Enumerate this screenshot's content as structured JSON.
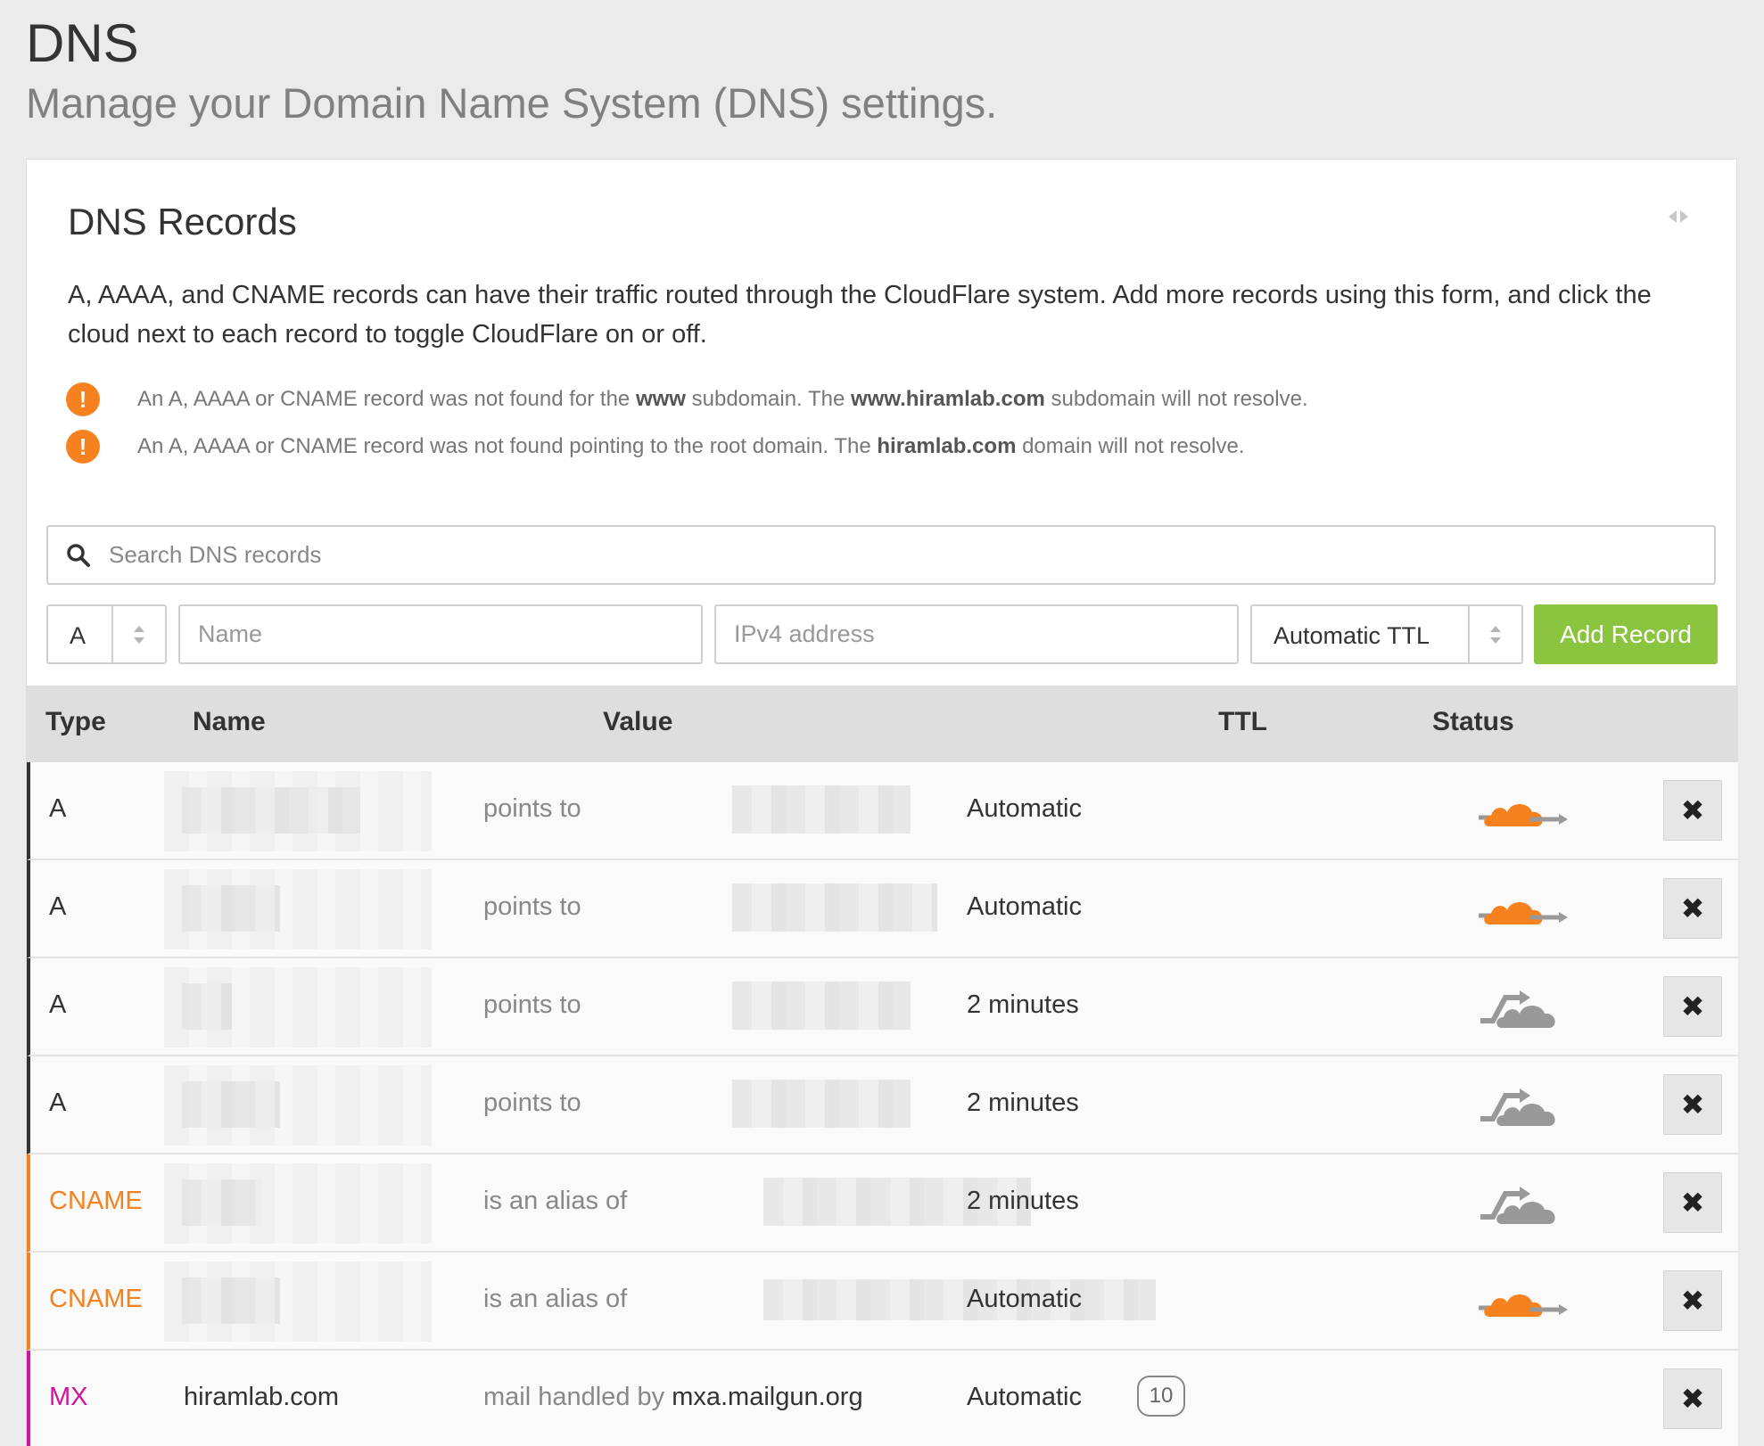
{
  "header": {
    "title": "DNS",
    "subtitle": "Manage your Domain Name System (DNS) settings."
  },
  "card": {
    "title": "DNS Records",
    "intro": "A, AAAA, and CNAME records can have their traffic routed through the CloudFlare system. Add more records using this form, and click the cloud next to each record to toggle CloudFlare on or off."
  },
  "alerts": [
    {
      "icon": "warning-icon",
      "pre": "An A, AAAA or CNAME record was not found for the ",
      "b1": "www",
      "mid": " subdomain. The ",
      "b2": "www.hiramlab.com",
      "post": " subdomain will not resolve."
    },
    {
      "icon": "warning-icon",
      "pre": "An A, AAAA or CNAME record was not found pointing to the root domain. The ",
      "b1": "hiramlab.com",
      "post": " domain will not resolve."
    }
  ],
  "search": {
    "placeholder": "Search DNS records"
  },
  "form": {
    "type_value": "A",
    "name_placeholder": "Name",
    "value_placeholder": "IPv4 address",
    "ttl_value": "Automatic TTL",
    "add_label": "Add Record"
  },
  "table": {
    "headers": {
      "type": "Type",
      "name": "Name",
      "value": "Value",
      "ttl": "TTL",
      "status": "Status"
    },
    "rows": [
      {
        "type": "A",
        "verb": "points to",
        "ttl": "Automatic",
        "status": "cloudflare-on"
      },
      {
        "type": "A",
        "verb": "points to",
        "ttl": "Automatic",
        "status": "cloudflare-on"
      },
      {
        "type": "A",
        "verb": "points to",
        "ttl": "2 minutes",
        "status": "cloudflare-off"
      },
      {
        "type": "A",
        "verb": "points to",
        "ttl": "2 minutes",
        "status": "cloudflare-off"
      },
      {
        "type": "CNAME",
        "verb": "is an alias of",
        "ttl": "2 minutes",
        "status": "cloudflare-off"
      },
      {
        "type": "CNAME",
        "verb": "is an alias of",
        "ttl": "Automatic",
        "status": "cloudflare-on"
      },
      {
        "type": "MX",
        "name": "hiramlab.com",
        "verb": "mail handled by",
        "target": "mxa.mailgun.org",
        "priority": "10",
        "ttl": "Automatic",
        "status": "none"
      }
    ],
    "delete_icon": "close-icon"
  },
  "colors": {
    "accent_orange": "#f6821f",
    "add_green": "#8bc53f",
    "mx_magenta": "#d1149b",
    "cloud_off_gray": "#999999"
  }
}
